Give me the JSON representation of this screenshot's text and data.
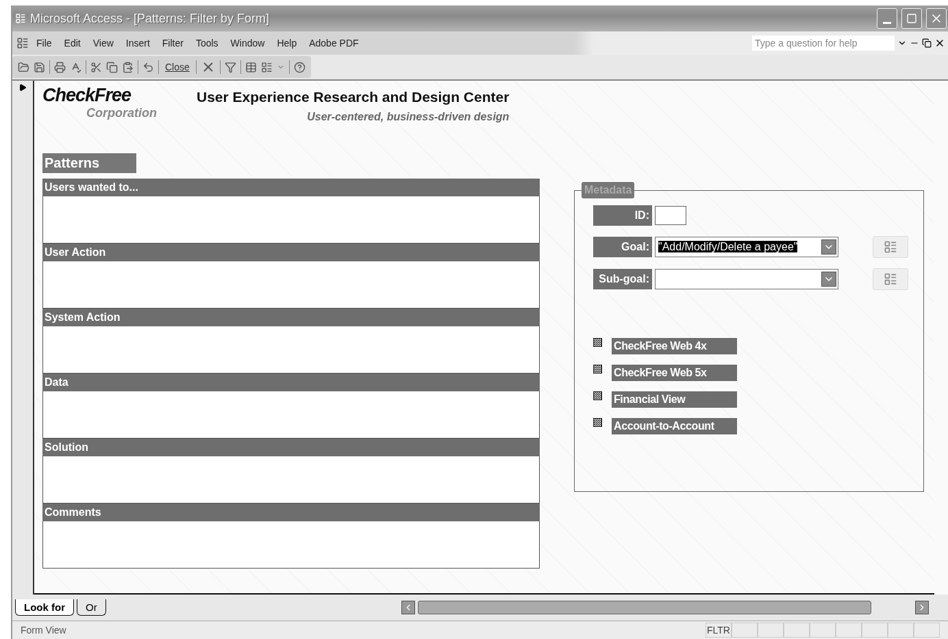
{
  "window": {
    "title": "Microsoft Access - [Patterns: Filter by Form]"
  },
  "menu": [
    "File",
    "Edit",
    "View",
    "Insert",
    "Filter",
    "Tools",
    "Window",
    "Help",
    "Adobe PDF"
  ],
  "help_box": {
    "placeholder": "Type a question for help"
  },
  "toolbar": {
    "close_label": "Close"
  },
  "header": {
    "logo": "CheckFree",
    "logo_sub": "Corporation",
    "title": "User Experience Research and Design Center",
    "tagline": "User-centered, business-driven design"
  },
  "patterns": {
    "title": "Patterns",
    "sections": [
      "Users wanted to...",
      "User Action",
      "System Action",
      "Data",
      "Solution",
      "Comments"
    ]
  },
  "metadata": {
    "legend": "Metadata",
    "fields": [
      {
        "label": "ID:",
        "kind": "text"
      },
      {
        "label": "Goal:",
        "kind": "combo",
        "value": "\"Add/Modify/Delete a payee\"",
        "highlighted": true
      },
      {
        "label": "Sub-goal:",
        "kind": "combo"
      }
    ],
    "checkboxes": [
      {
        "label": "CheckFree Web 4x",
        "indeterminate": true
      },
      {
        "label": "CheckFree Web 5x",
        "indeterminate": true
      },
      {
        "label": "Financial View",
        "indeterminate": true
      },
      {
        "label": "Account-to-Account",
        "indeterminate": true
      }
    ]
  },
  "tabs": [
    {
      "label": "Look for",
      "selected": true
    },
    {
      "label": "Or",
      "selected": false
    }
  ],
  "status_bar": {
    "mode": "Form View",
    "indicator": "FLTR"
  }
}
